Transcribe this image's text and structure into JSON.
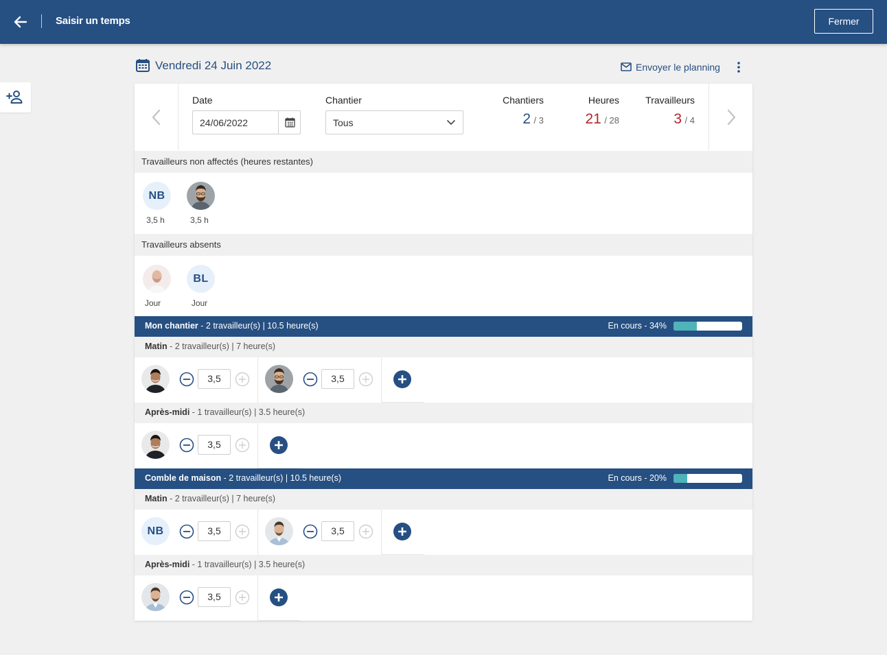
{
  "header": {
    "title": "Saisir un temps",
    "close_label": "Fermer",
    "back_icon": "arrow-left-icon"
  },
  "date_heading": "Vendredi 24 Juin 2022",
  "send_planning": "Envoyer le planning",
  "filters": {
    "date_label": "Date",
    "date_value": "24/06/2022",
    "chantier_label": "Chantier",
    "chantier_value": "Tous"
  },
  "stats": [
    {
      "name": "Chantiers",
      "value": "2",
      "total": "/ 3",
      "color": "#264f82"
    },
    {
      "name": "Heures",
      "value": "21",
      "total": "/ 28",
      "color": "#b3262d"
    },
    {
      "name": "Travailleurs",
      "value": "3",
      "total": "/ 4",
      "color": "#b3262d"
    }
  ],
  "unassigned": {
    "title": "Travailleurs non affectés (heures restantes)",
    "workers": [
      {
        "initials": "NB",
        "caption": "3,5 h"
      },
      {
        "initials": "",
        "caption": "3,5 h"
      }
    ]
  },
  "absent": {
    "title": "Travailleurs absents",
    "workers": [
      {
        "initials": "",
        "caption": "Jour"
      },
      {
        "initials": "BL",
        "caption": "Jour"
      }
    ]
  },
  "sites": [
    {
      "name": "Mon chantier",
      "summary": " - 2 travailleur(s) | 10.5 heure(s)",
      "status": "En cours - 34%",
      "progress": 34,
      "periods": [
        {
          "name": "Matin",
          "summary": " - 2 travailleur(s) | 7 heure(s)",
          "slots": [
            {
              "initials": "",
              "hours": "3,5"
            },
            {
              "initials": "",
              "hours": "3,5"
            }
          ]
        },
        {
          "name": "Après-midi",
          "summary": " - 1 travailleur(s) | 3.5 heure(s)",
          "slots": [
            {
              "initials": "",
              "hours": "3,5"
            }
          ]
        }
      ]
    },
    {
      "name": "Comble de maison",
      "summary": " - 2 travailleur(s) | 10.5 heure(s)",
      "status": "En cours - 20%",
      "progress": 20,
      "periods": [
        {
          "name": "Matin",
          "summary": " - 2 travailleur(s) | 7 heure(s)",
          "slots": [
            {
              "initials": "NB",
              "hours": "3,5"
            },
            {
              "initials": "",
              "hours": "3,5"
            }
          ]
        },
        {
          "name": "Après-midi",
          "summary": " - 1 travailleur(s) | 3.5 heure(s)",
          "slots": [
            {
              "initials": "",
              "hours": "3,5"
            }
          ]
        }
      ]
    }
  ],
  "colors": {
    "brand": "#264f82",
    "alert": "#b3262d",
    "progress": "#4fb3ba"
  }
}
